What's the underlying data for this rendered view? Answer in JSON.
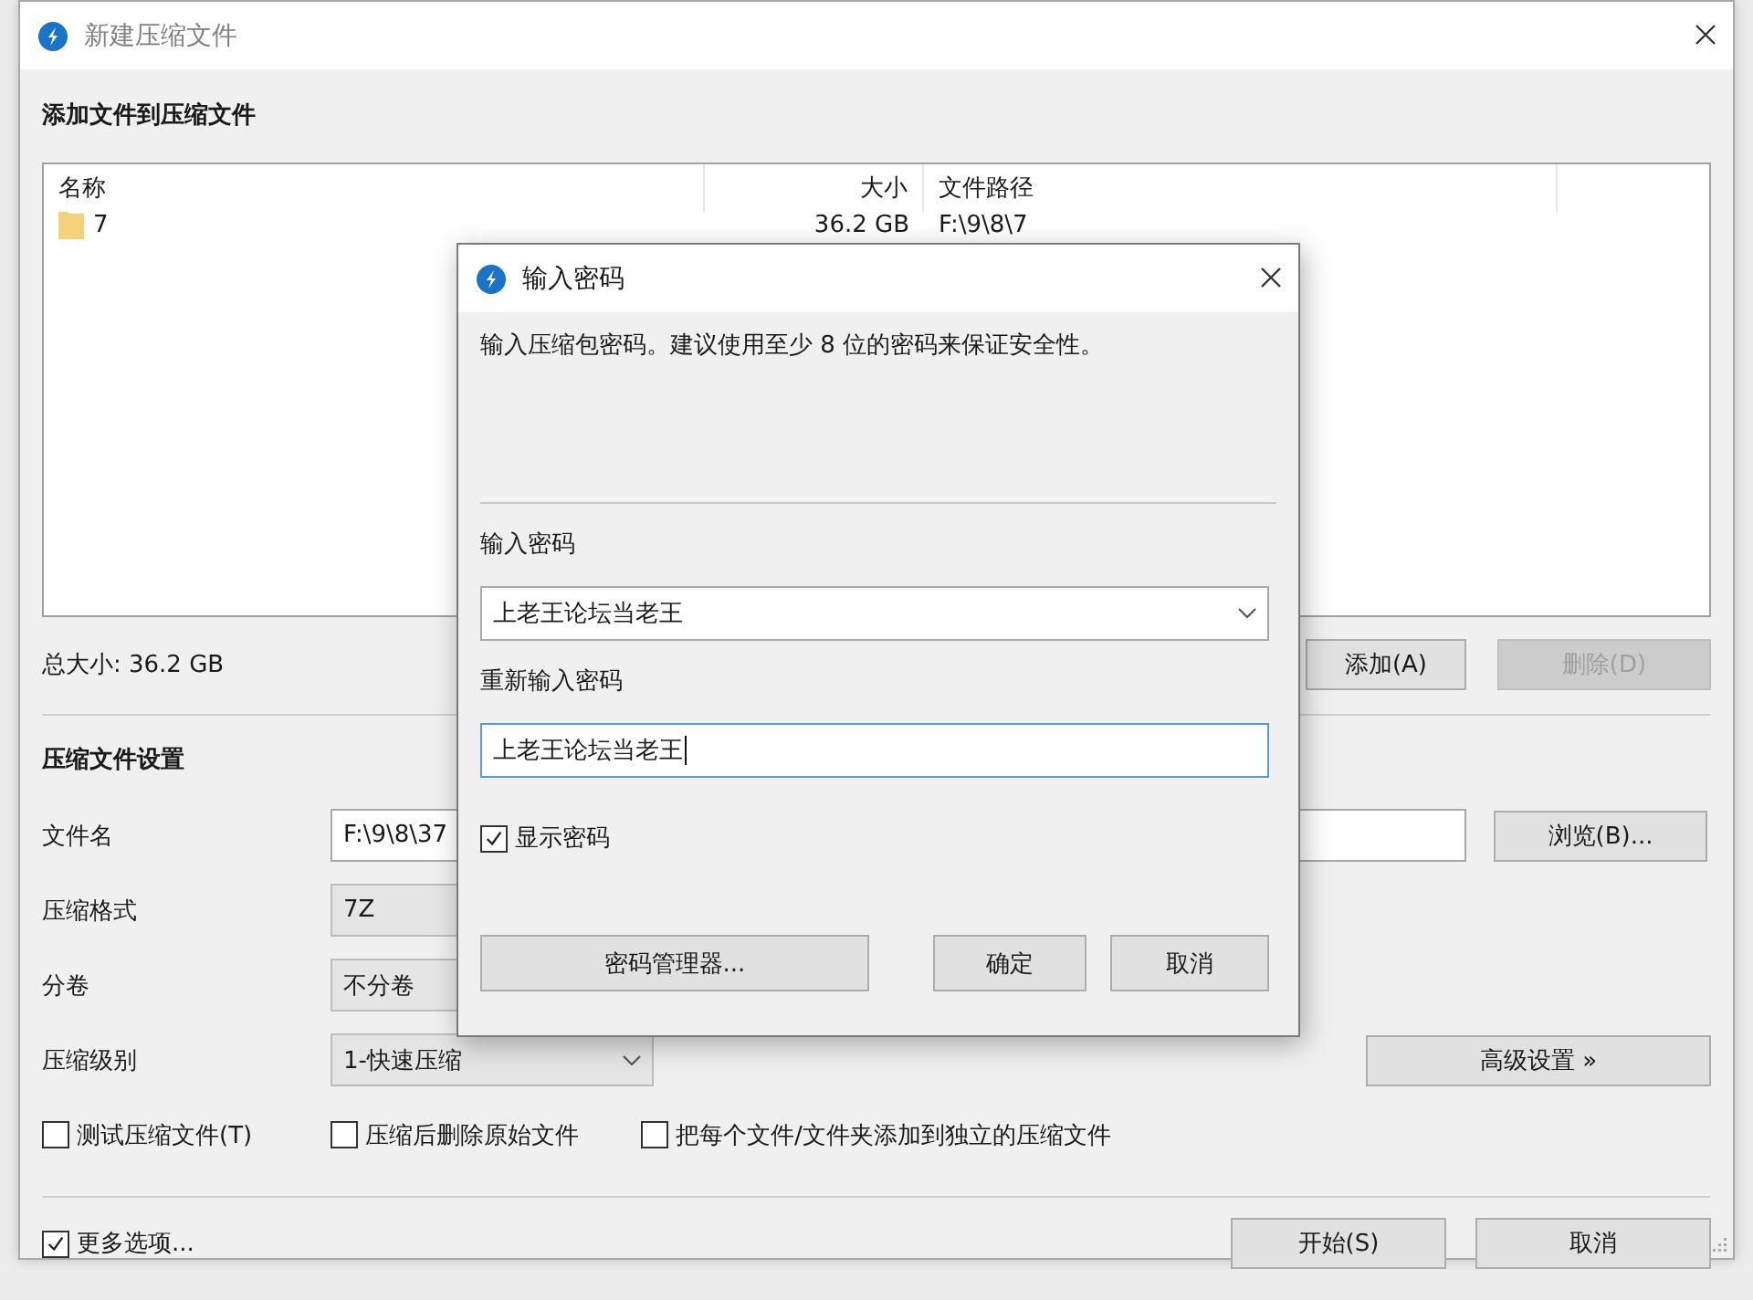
{
  "main_window": {
    "title": "新建压缩文件",
    "add_section_title": "添加文件到压缩文件",
    "file_list": {
      "columns": [
        "名称",
        "大小",
        "文件路径"
      ],
      "rows": [
        {
          "name": "7",
          "size": "36.2 GB",
          "path": "F:\\9\\8\\7"
        }
      ]
    },
    "total_size": "总大小: 36.2 GB",
    "list_buttons": [
      {
        "label": "添加(A)",
        "disabled": false
      },
      {
        "label": "删除(D)",
        "disabled": true
      }
    ],
    "settings_title": "压缩文件设置",
    "settings": [
      {
        "label": "文件名",
        "kind": "text",
        "value": "F:\\9\\8\\37"
      },
      {
        "label": "压缩格式",
        "kind": "select",
        "value": "7Z"
      },
      {
        "label": "分卷",
        "kind": "select",
        "value": "不分卷"
      },
      {
        "label": "压缩级别",
        "kind": "select",
        "value": "1-快速压缩",
        "caret": true
      }
    ],
    "browse_button": "浏览(B)...",
    "advanced_button": "高级设置 »",
    "options": [
      {
        "label": "测试压缩文件(T)",
        "checked": false
      },
      {
        "label": "压缩后删除原始文件",
        "checked": false
      },
      {
        "label": "把每个文件/文件夹添加到独立的压缩文件",
        "checked": false
      }
    ],
    "more_options": {
      "label": "更多选项...",
      "checked": true
    },
    "footer_buttons": [
      "开始(S)",
      "取消"
    ]
  },
  "password_dialog": {
    "title": "输入密码",
    "message": "输入压缩包密码。建议使用至少 8 位的密码来保证安全性。",
    "password_label": "输入密码",
    "password_value": "上老王论坛当老王",
    "confirm_label": "重新输入密码",
    "confirm_value": "上老王论坛当老王",
    "confirm_focused": true,
    "show_password": {
      "label": "显示密码",
      "checked": true
    },
    "buttons": [
      "密码管理器...",
      "确定",
      "取消"
    ]
  }
}
